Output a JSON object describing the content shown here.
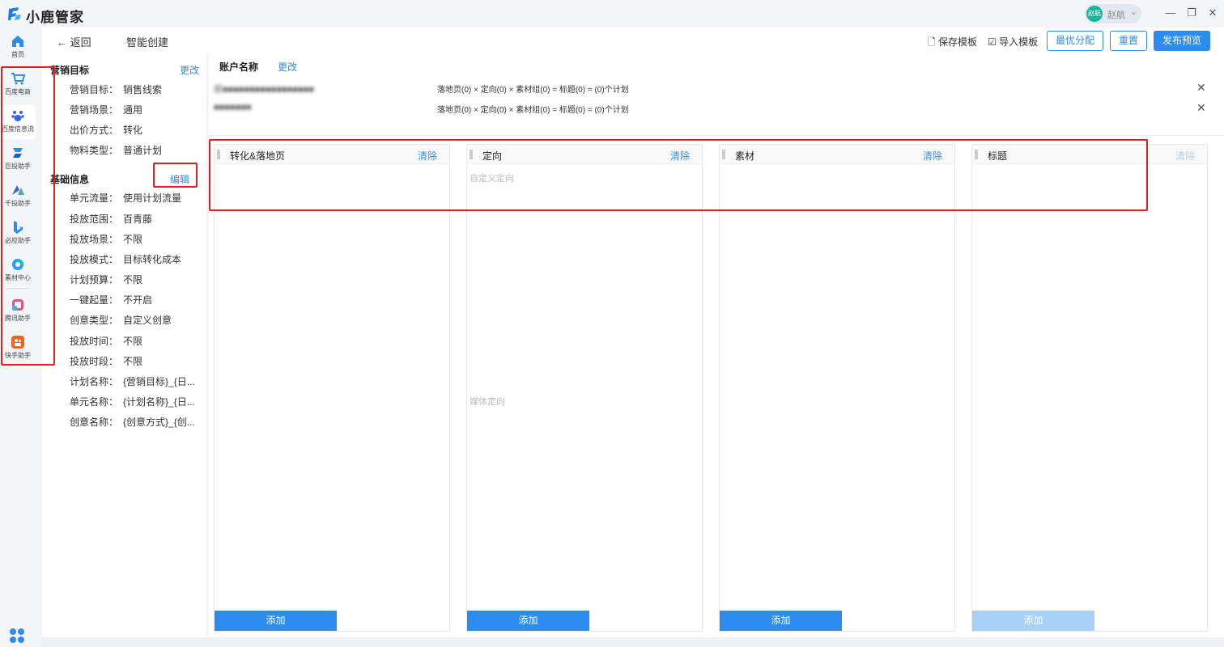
{
  "app": {
    "title": "小鹿管家"
  },
  "user": {
    "avatar_text": "赵航",
    "name": "赵航"
  },
  "nav": {
    "items": [
      {
        "label": "首页",
        "icon": "home-icon"
      },
      {
        "label": "百度电商",
        "icon": "cart-icon"
      },
      {
        "label": "百度信息流",
        "icon": "paw-icon"
      },
      {
        "label": "巨投助手",
        "icon": "ocean-icon"
      },
      {
        "label": "千投助手",
        "icon": "triangle-icon"
      },
      {
        "label": "必应助手",
        "icon": "bing-icon"
      },
      {
        "label": "素材中心",
        "icon": "material-icon"
      },
      {
        "label": "腾讯助手",
        "icon": "tencent-icon"
      },
      {
        "label": "快手助手",
        "icon": "kuaishou-icon"
      }
    ]
  },
  "header": {
    "back": "← 返回",
    "title": "智能创建",
    "save_template": "保存模板",
    "import_template": "导入模板",
    "optimal_alloc": "最优分配",
    "reset": "重置",
    "publish_preview": "发布预览"
  },
  "marketing": {
    "title": "营销目标",
    "change": "更改",
    "rows": [
      {
        "k": "营销目标：",
        "v": "销售线索"
      },
      {
        "k": "营销场景：",
        "v": "通用"
      },
      {
        "k": "出价方式：",
        "v": "转化"
      },
      {
        "k": "物料类型：",
        "v": "普通计划"
      }
    ]
  },
  "basic": {
    "title": "基础信息",
    "edit": "编辑",
    "rows": [
      {
        "k": "单元流量：",
        "v": "使用计划流量"
      },
      {
        "k": "投放范围：",
        "v": "百青藤"
      },
      {
        "k": "投放场景：",
        "v": "不限"
      },
      {
        "k": "投放模式：",
        "v": "目标转化成本"
      },
      {
        "k": "计划预算：",
        "v": "不限"
      },
      {
        "k": "一键起量：",
        "v": "不开启"
      },
      {
        "k": "创意类型：",
        "v": "自定义创意"
      },
      {
        "k": "投放时间：",
        "v": "不限"
      },
      {
        "k": "投放时段：",
        "v": "不限"
      },
      {
        "k": "计划名称：",
        "v": "{营销目标}_{日..."
      },
      {
        "k": "单元名称：",
        "v": "{计划名称}_{日..."
      },
      {
        "k": "创意名称：",
        "v": "{创意方式}_{创..."
      }
    ]
  },
  "accounts": {
    "label": "账户名称",
    "change": "更改",
    "rows": [
      {
        "name": "原■■■■■■■■■■■■■■■■■",
        "formula": "落地页(0) × 定向(0) × 素材组(0) = 标题(0) = (0)个计划"
      },
      {
        "name": "■■■■■■■",
        "formula": "落地页(0) × 定向(0) × 素材组(0) = 标题(0) = (0)个计划"
      }
    ]
  },
  "columns": [
    {
      "title": "转化&落地页",
      "clear": "清除",
      "add": "添加",
      "hints": []
    },
    {
      "title": "定向",
      "clear": "清除",
      "add": "添加",
      "hints": [
        "自定义定向",
        "媒体定向"
      ]
    },
    {
      "title": "素材",
      "clear": "清除",
      "add": "添加",
      "hints": []
    },
    {
      "title": "标题",
      "clear": "清除",
      "add": "添加",
      "hints": []
    }
  ],
  "colors": {
    "accent": "#2d8cf0",
    "accent_disabled": "#a9d1f7",
    "annotation": "#e02020"
  }
}
